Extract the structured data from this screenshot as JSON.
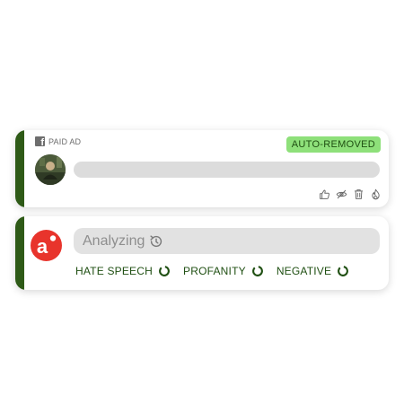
{
  "ad_card": {
    "source_label": "PAID AD",
    "source_icon": "facebook-icon",
    "status_badge": "AUTO-REMOVED",
    "action_icons": [
      "thumbs-up-icon",
      "eye-off-icon",
      "trash-icon",
      "fire-icon"
    ]
  },
  "analyze_card": {
    "logo_letter": "a",
    "status_text": "Analyzing",
    "status_icon": "refresh-icon",
    "tags": [
      {
        "label": "HATE SPEECH",
        "icon": "spinner-icon"
      },
      {
        "label": "PROFANITY",
        "icon": "spinner-icon"
      },
      {
        "label": "NEGATIVE",
        "icon": "spinner-icon"
      }
    ]
  },
  "colors": {
    "accent_green": "#2e5a17",
    "badge_bg": "#8ee07a",
    "badge_text": "#1f4f12",
    "logo_red": "#e8342c",
    "tag_green": "#1f4f12"
  }
}
